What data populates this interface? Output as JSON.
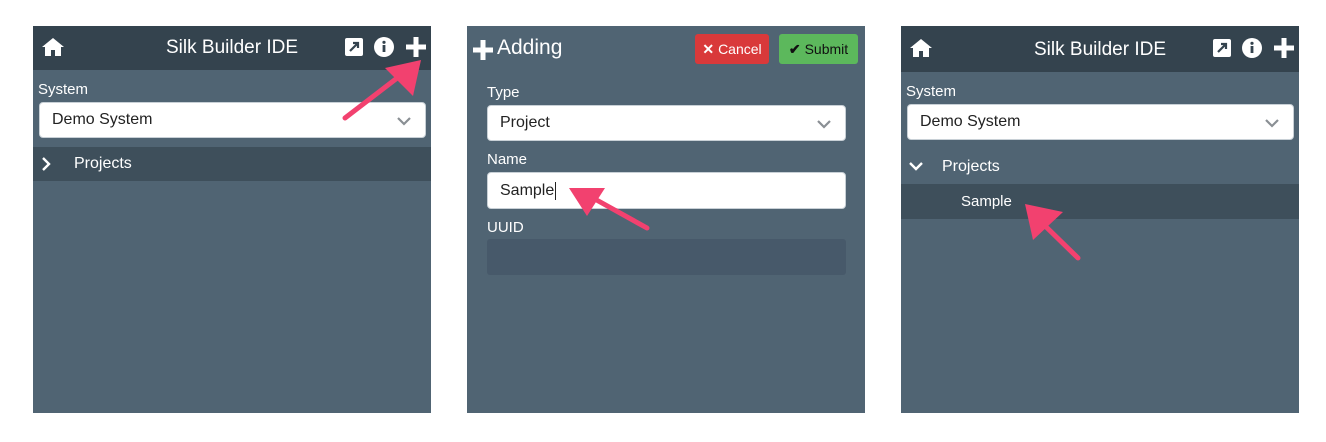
{
  "panel1": {
    "header": {
      "title": "Silk Builder IDE",
      "icons": [
        "home-icon",
        "external-link-icon",
        "info-icon",
        "plus-icon"
      ]
    },
    "system_label": "System",
    "system_select": {
      "value": "Demo System"
    },
    "tree": {
      "projects_label": "Projects",
      "expanded": false
    }
  },
  "panel2": {
    "header": {
      "title": "Adding",
      "cancel_label": "Cancel",
      "submit_label": "Submit"
    },
    "type_label": "Type",
    "type_select": {
      "value": "Project"
    },
    "name_label": "Name",
    "name_input": {
      "value": "Sample"
    },
    "uuid_label": "UUID",
    "uuid_input": {
      "value": ""
    }
  },
  "panel3": {
    "header": {
      "title": "Silk Builder IDE"
    },
    "system_label": "System",
    "system_select": {
      "value": "Demo System"
    },
    "tree": {
      "projects_label": "Projects",
      "expanded": true,
      "child_label": "Sample"
    }
  },
  "colors": {
    "panel_bg": "#506473",
    "header_bg": "#34434e",
    "highlight_row": "#3e4f5b",
    "cancel": "#d9393a",
    "submit": "#5cb85c",
    "callout_arrow": "#f2416f"
  }
}
